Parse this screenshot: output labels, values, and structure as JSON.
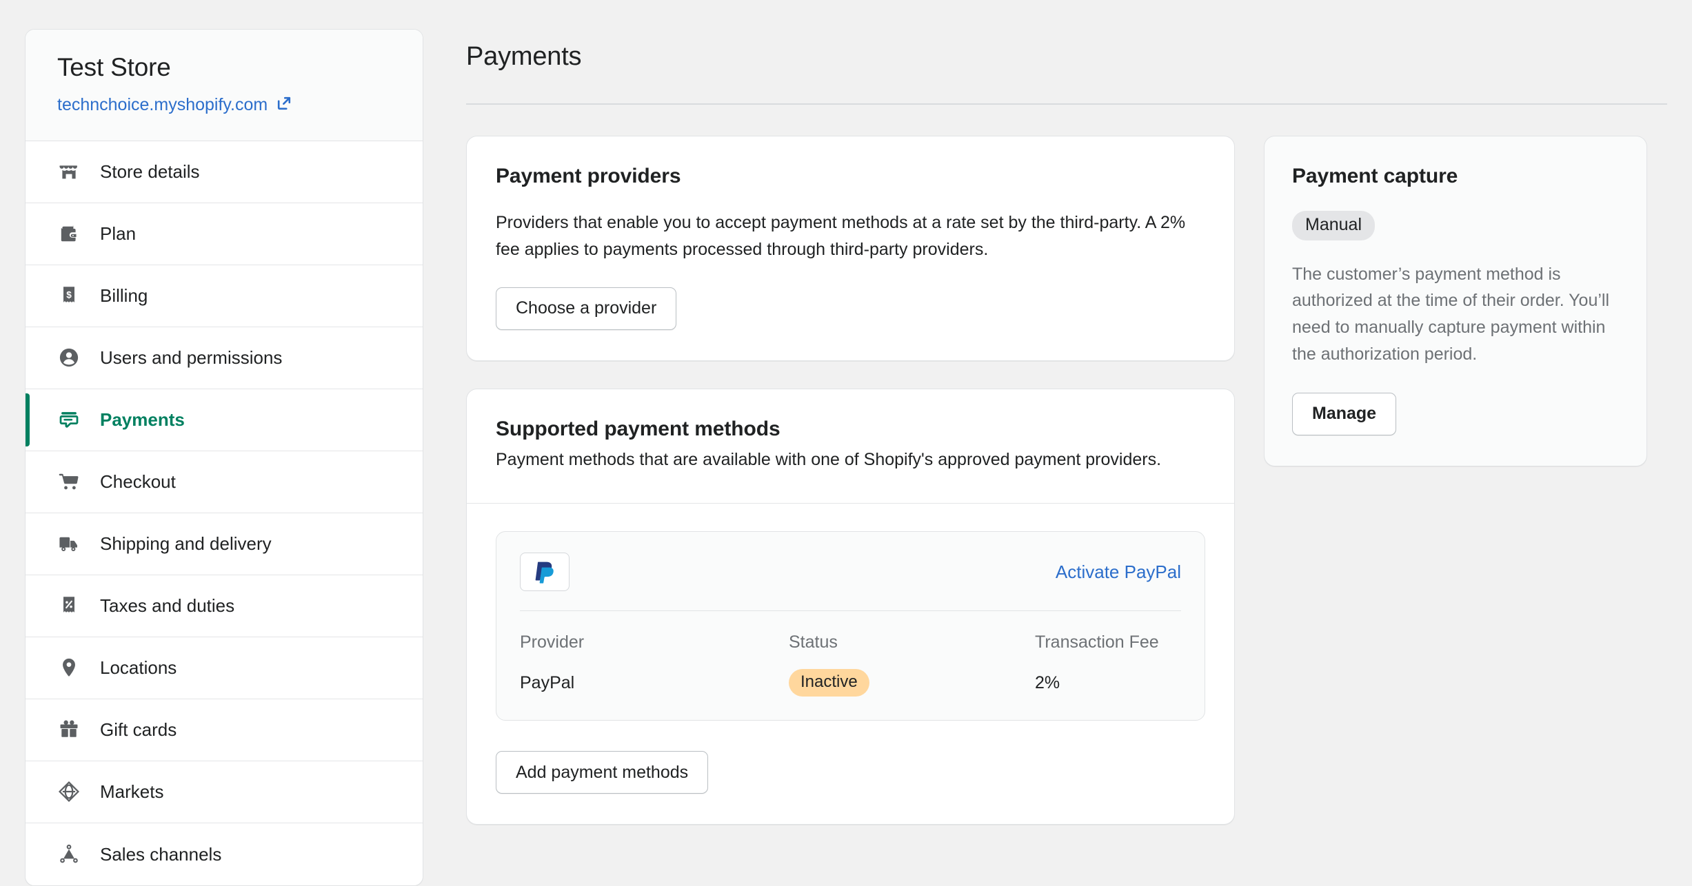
{
  "sidebar": {
    "store_name": "Test Store",
    "store_url": "technchoice.myshopify.com",
    "items": [
      {
        "label": "Store details",
        "icon": "store-icon",
        "active": false
      },
      {
        "label": "Plan",
        "icon": "wallet-icon",
        "active": false
      },
      {
        "label": "Billing",
        "icon": "receipt-dollar-icon",
        "active": false
      },
      {
        "label": "Users and permissions",
        "icon": "person-icon",
        "active": false
      },
      {
        "label": "Payments",
        "icon": "payment-card-icon",
        "active": true
      },
      {
        "label": "Checkout",
        "icon": "shopping-cart-icon",
        "active": false
      },
      {
        "label": "Shipping and delivery",
        "icon": "delivery-truck-icon",
        "active": false
      },
      {
        "label": "Taxes and duties",
        "icon": "receipt-percent-icon",
        "active": false
      },
      {
        "label": "Locations",
        "icon": "map-pin-icon",
        "active": false
      },
      {
        "label": "Gift cards",
        "icon": "gift-box-icon",
        "active": false
      },
      {
        "label": "Markets",
        "icon": "globe-icon",
        "active": false
      },
      {
        "label": "Sales channels",
        "icon": "channels-network-icon",
        "active": false
      }
    ]
  },
  "main": {
    "page_title": "Payments",
    "providers_card": {
      "title": "Payment providers",
      "description": "Providers that enable you to accept payment methods at a rate set by the third-party. A 2% fee applies to payments processed through third-party providers.",
      "button_label": "Choose a provider"
    },
    "methods_card": {
      "title": "Supported payment methods",
      "description": "Payment methods that are available with one of Shopify's approved payment providers.",
      "add_button_label": "Add payment methods",
      "provider_entry": {
        "logo": "paypal-logo",
        "activate_link": "Activate PayPal",
        "columns": [
          "Provider",
          "Status",
          "Transaction Fee"
        ],
        "values": [
          "PayPal",
          "Inactive",
          "2%"
        ]
      }
    }
  },
  "capture_card": {
    "title": "Payment capture",
    "badge": "Manual",
    "description": "The customer’s payment method is authorized at the time of their order. You’ll need to manually capture payment within the authorization period.",
    "button_label": "Manage"
  },
  "colors": {
    "accent_green": "#008060",
    "link_blue": "#2c6ecb",
    "badge_inactive_bg": "#ffd79d",
    "badge_manual_bg": "#e4e5e7",
    "paypal_dark": "#253b80",
    "paypal_light": "#179bd7"
  }
}
